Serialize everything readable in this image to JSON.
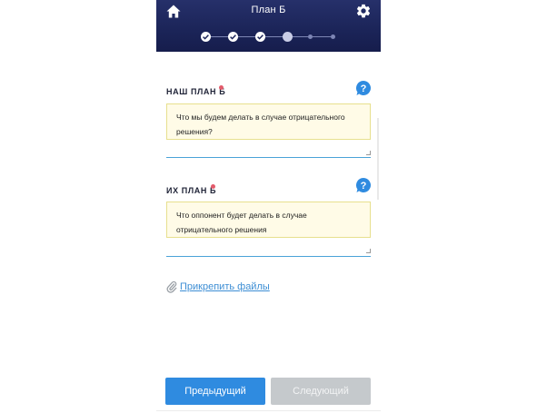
{
  "header": {
    "title": "План Б",
    "home_icon": "home-icon",
    "settings_icon": "gear-icon",
    "steps": [
      "done",
      "done",
      "done",
      "current",
      "todo",
      "todo"
    ]
  },
  "our_plan": {
    "label": "НАШ ПЛАН Б",
    "placeholder": "Что мы будем делать в случае отрицательного решения?"
  },
  "their_plan": {
    "label": "ИХ ПЛАН Б",
    "placeholder": "Что оппонент будет делать в случае отрицательного решения"
  },
  "attach": {
    "label": "Прикрепить файлы",
    "icon": "paperclip-icon"
  },
  "buttons": {
    "prev": "Предыдущий",
    "next": "Следующий"
  },
  "colors": {
    "header": "#1b2458",
    "accent": "#2f8be0",
    "disabled": "#c5c9cc",
    "field_bg": "#fffbe7",
    "required_dot": "#e35b6b"
  }
}
